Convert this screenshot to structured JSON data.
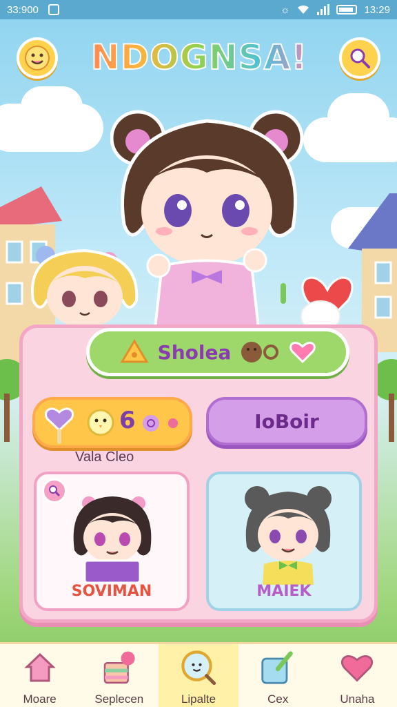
{
  "status_bar": {
    "time_left": "33:900",
    "time_right": "13:29"
  },
  "header": {
    "title": "NDOGNSA!",
    "left_icon": "smiley-icon",
    "right_icon": "search-icon"
  },
  "panel": {
    "title": "Sholea",
    "stat_value": "6",
    "stat_label": "Vala Cleo",
    "action_label": "IoBoir",
    "cards": [
      {
        "label": "SOVIMAN"
      },
      {
        "label": "MAIEK"
      }
    ]
  },
  "nav": {
    "items": [
      {
        "label": "Moare",
        "icon": "home-icon"
      },
      {
        "label": "Seplecen",
        "icon": "cake-icon"
      },
      {
        "label": "Lipalte",
        "icon": "search-face-icon",
        "active": true
      },
      {
        "label": "Cex",
        "icon": "paint-icon"
      },
      {
        "label": "Unaha",
        "icon": "heart-icon"
      }
    ]
  },
  "colors": {
    "accent": "#f4a6c6",
    "primary": "#d59ee8",
    "sky": "#8ed3ef",
    "grass": "#9fd67a"
  }
}
